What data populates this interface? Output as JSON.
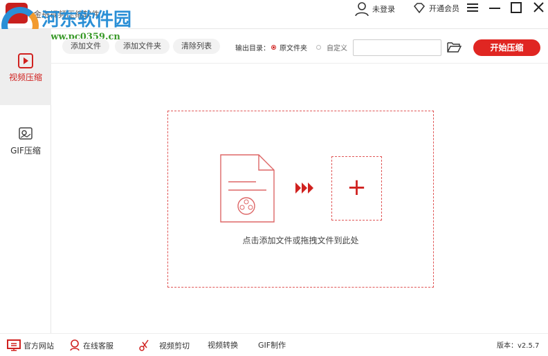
{
  "app": {
    "title": "金舟视频压缩软件",
    "watermark": "河东软件园",
    "watermark_url": "www.pc0359.cn"
  },
  "topbar": {
    "login": "未登录",
    "vip": "开通会员"
  },
  "sidebar": {
    "items": [
      {
        "label": "视频压缩"
      },
      {
        "label": "GIF压缩"
      }
    ]
  },
  "toolbar": {
    "add_file": "添加文件",
    "add_folder": "添加文件夹",
    "clear_list": "清除列表",
    "output_label": "输出目录：",
    "opt_original": "原文件夹",
    "opt_custom": "自定义",
    "path_value": "",
    "start": "开始压缩"
  },
  "drop": {
    "hint": "点击添加文件或拖拽文件到此处",
    "plus": "+"
  },
  "footer": {
    "website": "官方网站",
    "support": "在线客服",
    "cut": "视频剪切",
    "convert": "视频转换",
    "gif": "GIF制作",
    "version": "版本：v2.5.7"
  },
  "colors": {
    "accent": "#d0211f"
  }
}
